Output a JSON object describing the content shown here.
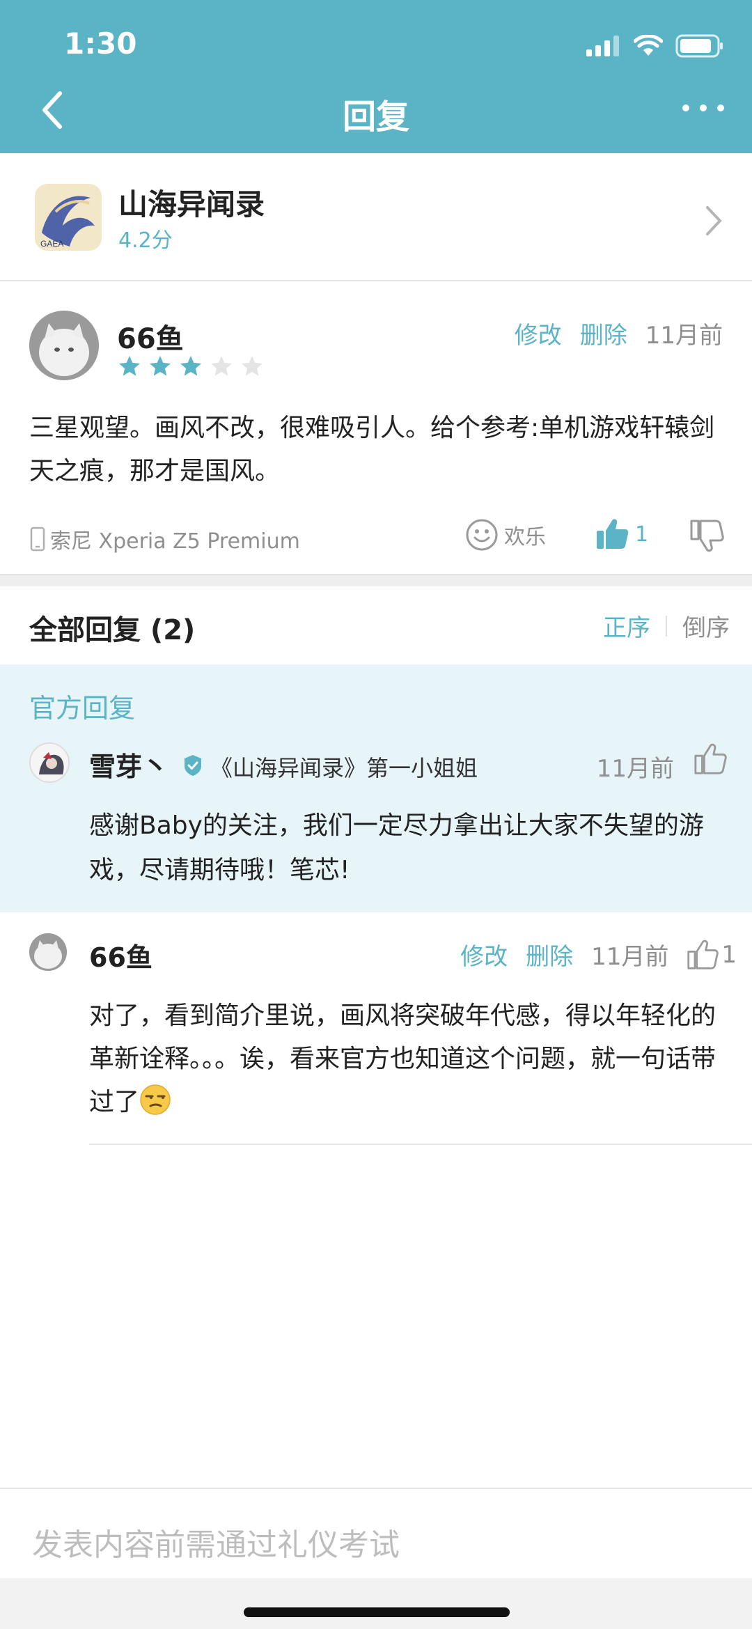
{
  "status_bar": {
    "time": "1:30"
  },
  "header": {
    "title": "回复"
  },
  "game": {
    "name": "山海异闻录",
    "score": "4.2分",
    "icon_label": "GAEA"
  },
  "review": {
    "user": "66鱼",
    "rating": 3,
    "rating_max": 5,
    "edit_label": "修改",
    "delete_label": "删除",
    "time": "11月前",
    "text": "三星观望。画风不改，很难吸引人。给个参考:单机游戏轩辕剑天之痕，那才是国风。",
    "device": "索尼 Xperia Z5 Premium",
    "emotion": "欢乐",
    "like_count": "1"
  },
  "replies": {
    "title": "全部回复 (2)",
    "sort_asc": "正序",
    "sort_desc": "倒序"
  },
  "official_reply": {
    "label": "官方回复",
    "user": "雪芽丶",
    "tag": "《山海异闻录》第一小姐姐",
    "time": "11月前",
    "text": "感谢Baby的关注，我们一定尽力拿出让大家不失望的游戏，尽请期待哦！笔芯!"
  },
  "reply2": {
    "user": "66鱼",
    "edit_label": "修改",
    "delete_label": "删除",
    "time": "11月前",
    "like_count": "1",
    "text": "对了，看到简介里说，画风将突破年代感，得以年轻化的革新诠释。。。诶，看来官方也知道这个问题，就一句话带过了",
    "emoji": "unamused-face"
  },
  "composer": {
    "placeholder": "发表内容前需通过礼仪考试"
  },
  "colors": {
    "accent": "#5ab4c5",
    "official_bg": "#e8f5f8"
  }
}
